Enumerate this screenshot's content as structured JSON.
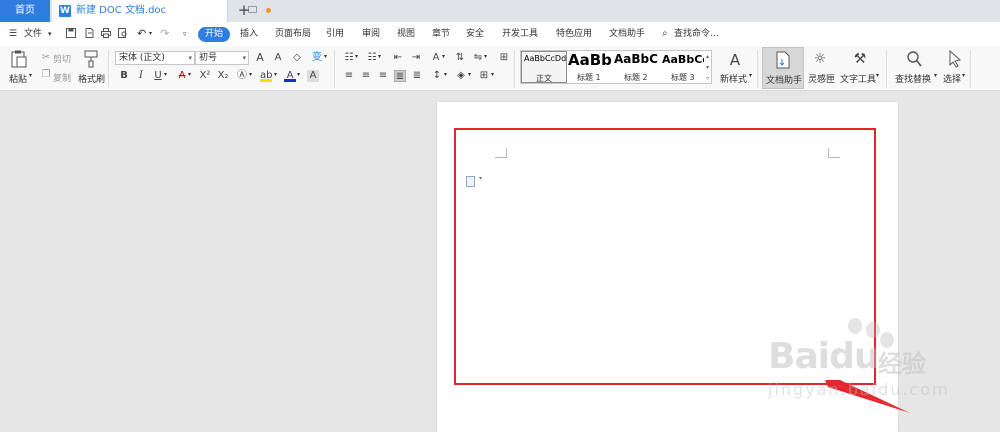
{
  "tabs": {
    "home": "首页",
    "doc_title": "新建 DOC 文档.doc",
    "new_tab_icon": "plus-icon"
  },
  "menu": {
    "file": "文件",
    "items": [
      "开始",
      "插入",
      "页面布局",
      "引用",
      "审阅",
      "视图",
      "章节",
      "安全",
      "开发工具",
      "特色应用",
      "文档助手"
    ],
    "search": "查找命令..."
  },
  "ribbon": {
    "clipboard": {
      "paste": "粘贴",
      "cut": "剪切",
      "copy": "复制",
      "format_painter": "格式刷"
    },
    "font": {
      "name": "宋体 (正文)",
      "size": "初号"
    },
    "styles": [
      {
        "sample": "AaBbCcDd",
        "name": "正文"
      },
      {
        "sample": "AaBb",
        "name": "标题 1"
      },
      {
        "sample": "AaBbC",
        "name": "标题 2"
      },
      {
        "sample": "AaBbCc",
        "name": "标题 3"
      }
    ],
    "new_style": "新样式",
    "doc_helper": "文档助手",
    "inspiration": "灵感匣",
    "text_tools": "文字工具",
    "find_replace": "查找替换",
    "select": "选择"
  },
  "watermark": {
    "brand": "Baidu",
    "brand_cn": "经验",
    "site": "jingyan.baidu.com"
  },
  "colors": {
    "accent": "#2f7de1",
    "highlight": "#e3262c",
    "tab_dot": "#f39325"
  }
}
